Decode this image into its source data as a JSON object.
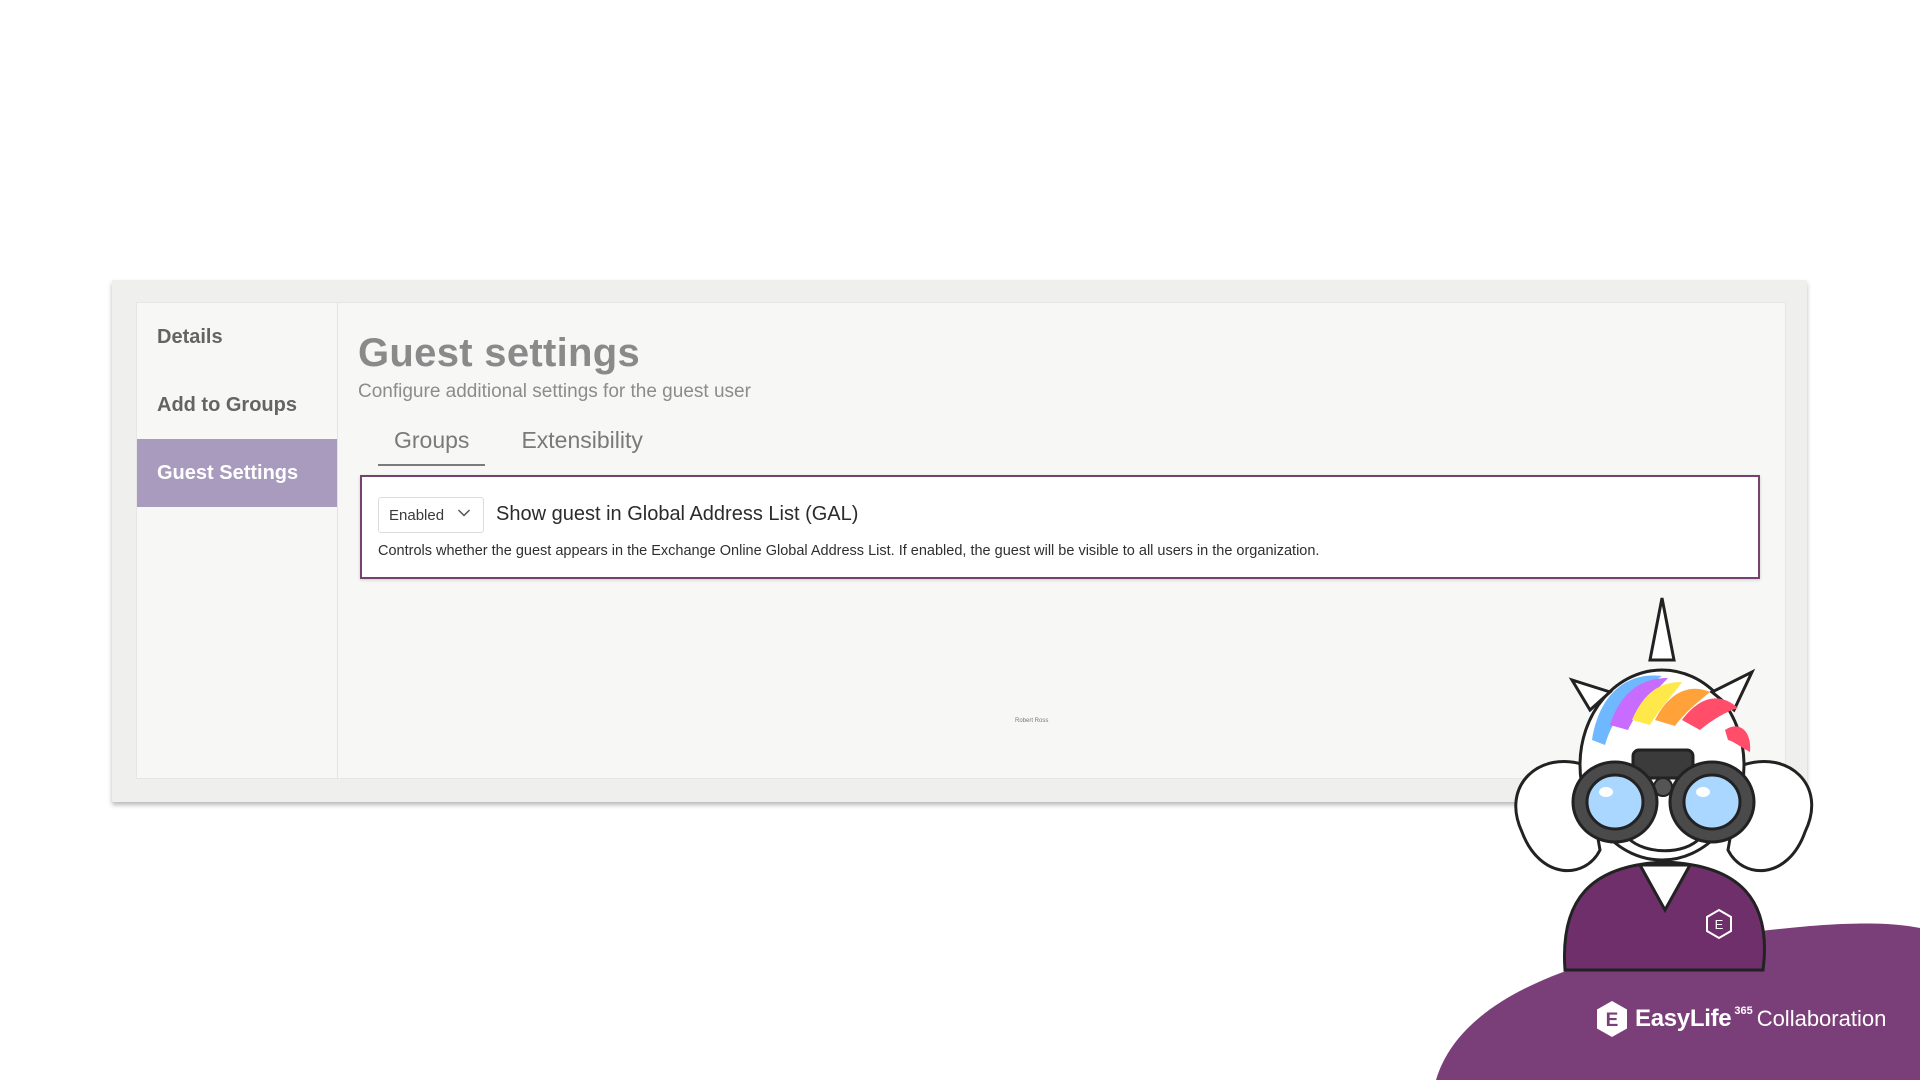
{
  "sidebar": {
    "items": [
      {
        "label": "Details"
      },
      {
        "label": "Add to Groups"
      },
      {
        "label": "Guest Settings"
      }
    ]
  },
  "main": {
    "title": "Guest settings",
    "subtitle": "Configure additional settings for the guest user",
    "tabs": [
      {
        "label": "Groups"
      },
      {
        "label": "Extensibility"
      }
    ],
    "setting": {
      "dropdown_value": "Enabled",
      "title": "Show guest in Global Address List (GAL)",
      "description": "Controls whether the guest appears in the Exchange Online Global Address List. If enabled, the guest will be visible to all users in the organization."
    },
    "footer_user": "Robert Ross"
  },
  "brand": {
    "name": "EasyLife",
    "sup": "365",
    "product": "Collaboration",
    "hex_letter": "E",
    "mascot_badge_letter": "E",
    "colors": {
      "primary": "#7a3f78",
      "accent": "#75416e",
      "nav_active": "#a89bbe"
    }
  },
  "icons": {
    "dropdown": "chevron-down-icon",
    "logo": "easylife-hex-icon",
    "mascot": "unicorn-binoculars-mascot"
  }
}
